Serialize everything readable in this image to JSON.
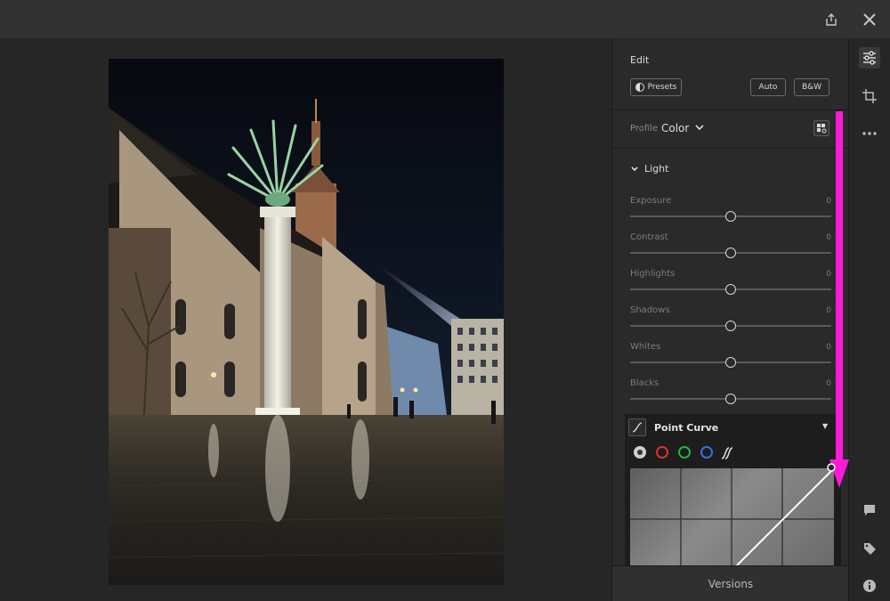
{
  "panel": {
    "title": "Edit",
    "presets_label": "Presets",
    "auto_label": "Auto",
    "bw_label": "B&W",
    "profile_label": "Profile",
    "profile_value": "Color",
    "light_section": "Light",
    "sliders": [
      {
        "label": "Exposure",
        "value": "0",
        "level": 0.5
      },
      {
        "label": "Contrast",
        "value": "0",
        "level": 0.5
      },
      {
        "label": "Highlights",
        "value": "0",
        "level": 0.5
      },
      {
        "label": "Shadows",
        "value": "0",
        "level": 0.5
      },
      {
        "label": "Whites",
        "value": "0",
        "level": 0.5
      },
      {
        "label": "Blacks",
        "value": "0",
        "level": 0.5
      }
    ],
    "point_curve_label": "Point Curve",
    "curve_channels": [
      {
        "name": "rgb",
        "color": "#d0d0d0"
      },
      {
        "name": "red",
        "color": "#e03030"
      },
      {
        "name": "green",
        "color": "#22b24c"
      },
      {
        "name": "blue",
        "color": "#3a6fe0"
      }
    ],
    "versions_label": "Versions"
  },
  "colors": {
    "annotation_arrow": "#ff1ad9",
    "panel_bg": "#2a2a2a"
  },
  "icons": {
    "top": [
      "share-icon",
      "close-icon"
    ],
    "right_top": [
      "edit-sliders-icon",
      "crop-icon",
      "more-icon"
    ],
    "right_bottom": [
      "comment-icon",
      "tag-icon",
      "info-icon"
    ]
  }
}
